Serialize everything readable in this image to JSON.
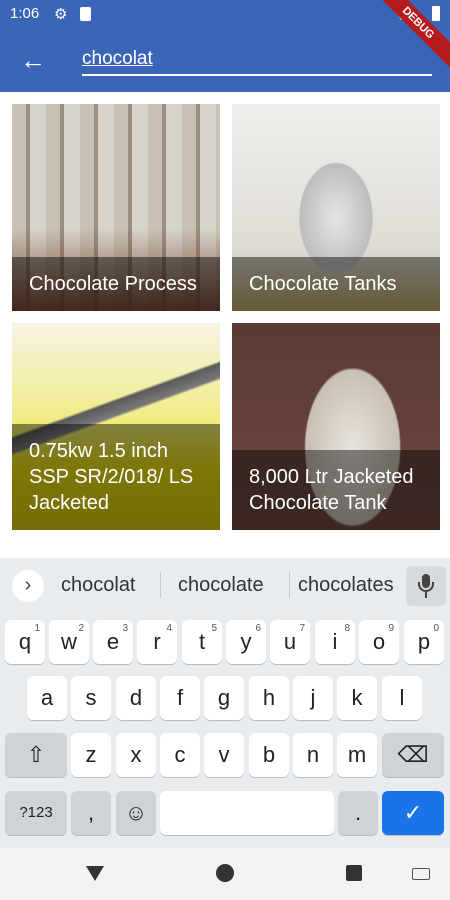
{
  "status_bar": {
    "time": "1:06"
  },
  "debug_banner": "DEBUG",
  "search": {
    "value": "chocolat"
  },
  "results": [
    {
      "title": "Chocolate Process"
    },
    {
      "title": "Chocolate Tanks"
    },
    {
      "title": "0.75kw 1.5 inch SSP SR/2/018/ LS Jacketed"
    },
    {
      "title": "8,000 Ltr Jacketed Chocolate Tank"
    }
  ],
  "keyboard": {
    "suggestions": [
      "chocolat",
      "chocolate",
      "chocolates"
    ],
    "row1": [
      {
        "label": "q",
        "hint": "1"
      },
      {
        "label": "w",
        "hint": "2"
      },
      {
        "label": "e",
        "hint": "3"
      },
      {
        "label": "r",
        "hint": "4"
      },
      {
        "label": "t",
        "hint": "5"
      },
      {
        "label": "y",
        "hint": "6"
      },
      {
        "label": "u",
        "hint": "7"
      },
      {
        "label": "i",
        "hint": "8"
      },
      {
        "label": "o",
        "hint": "9"
      },
      {
        "label": "p",
        "hint": "0"
      }
    ],
    "row2": [
      "a",
      "s",
      "d",
      "f",
      "g",
      "h",
      "j",
      "k",
      "l"
    ],
    "row3": [
      "z",
      "x",
      "c",
      "v",
      "b",
      "n",
      "m"
    ],
    "symbols_label": "?123",
    "comma_label": ",",
    "period_label": ".",
    "enter_label": "✓",
    "shift_icon": "shift-icon",
    "backspace_icon": "backspace-icon",
    "emoji_icon": "emoji-icon"
  },
  "colors": {
    "app_bar": "#3b66b8",
    "enter_key": "#1a73e8",
    "ribbon": "#b71c1c"
  }
}
